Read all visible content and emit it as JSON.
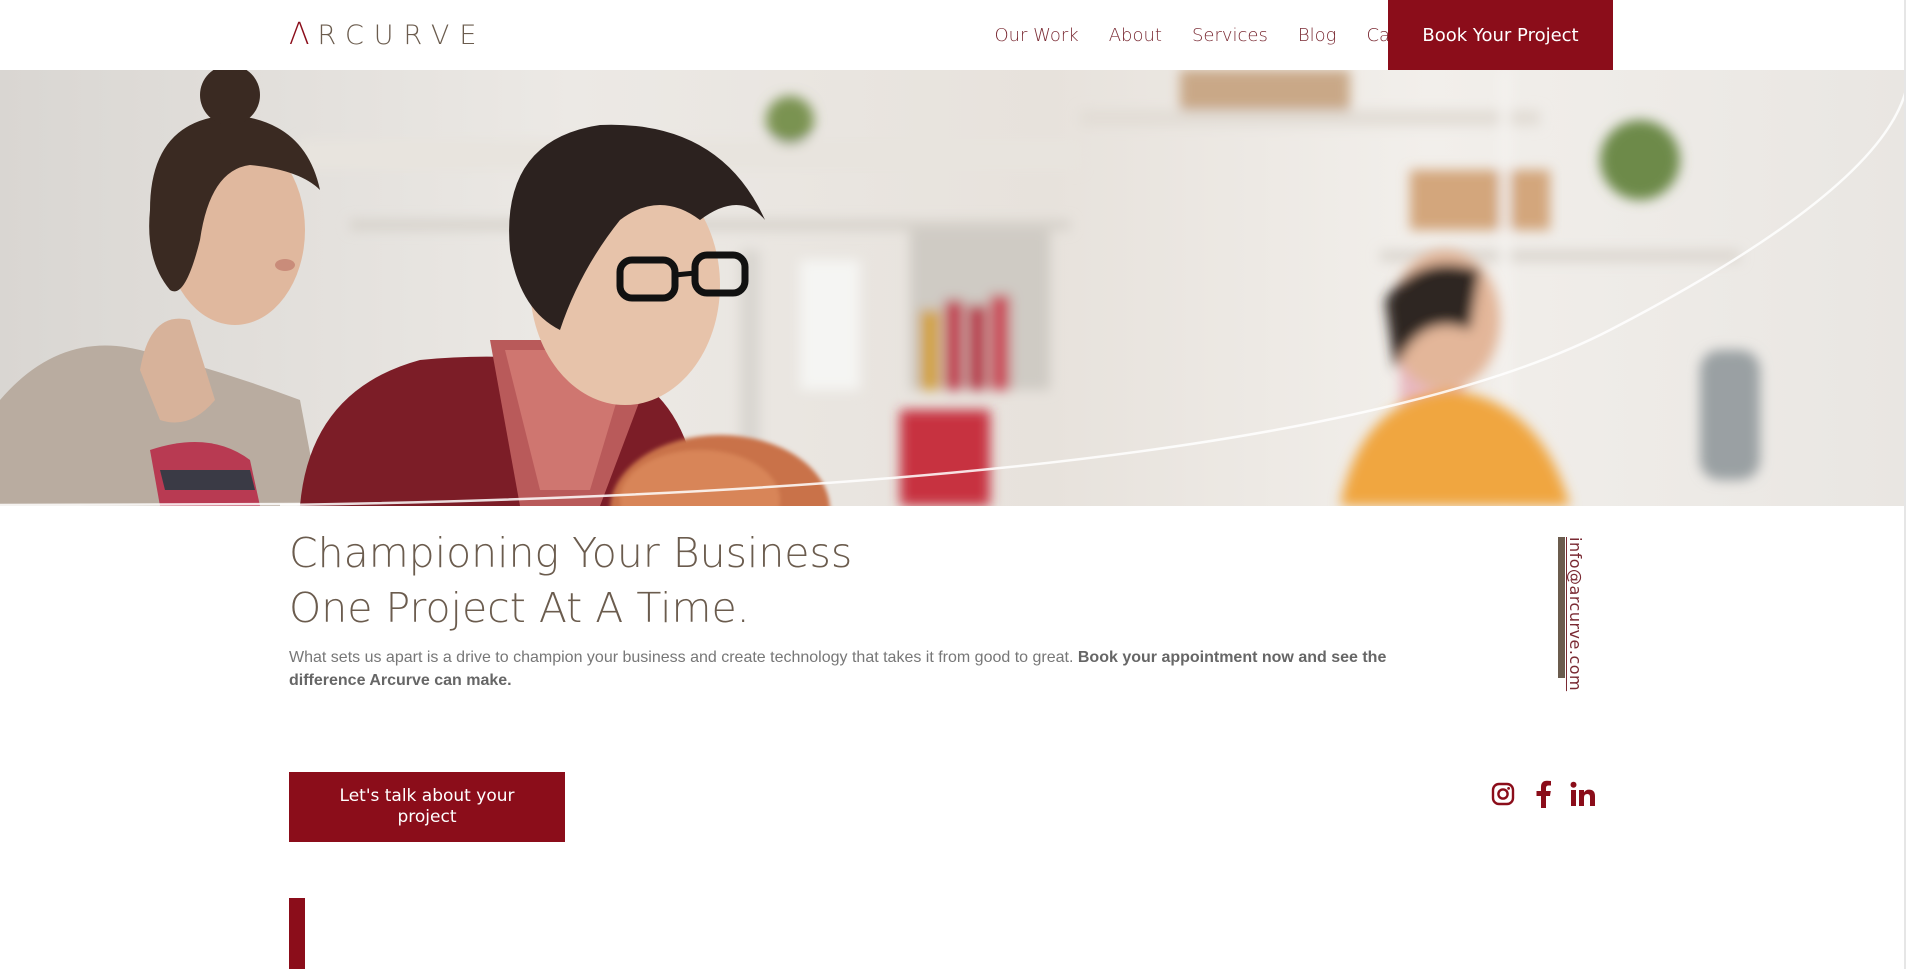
{
  "brand": {
    "logo_a": "Λ",
    "logo_rest": "RCURVE",
    "logo_label": "ARCURVE"
  },
  "nav": {
    "items": [
      {
        "label": "Our Work"
      },
      {
        "label": "About"
      },
      {
        "label": "Services"
      },
      {
        "label": "Blog"
      },
      {
        "label": "Careers"
      }
    ],
    "book_label": "Book Your Project"
  },
  "hero": {
    "title_line1": "Championing Your Business",
    "title_line2": "One Project At A Time.",
    "description": "What sets us apart is a drive to champion your business and create technology that takes it from good to great.",
    "description_bold": "Book your appointment now and see the difference Arcurve can make.",
    "email": "info@arcurve.com",
    "cta_label": "Let's talk about your project"
  },
  "socials": [
    {
      "icon": "instagram-icon"
    },
    {
      "icon": "facebook-icon"
    },
    {
      "icon": "linkedin-icon"
    }
  ],
  "colors": {
    "brand_red": "#8b0d1a",
    "brand_brown": "#6b5c4e",
    "nav_text": "#7a2a33"
  }
}
